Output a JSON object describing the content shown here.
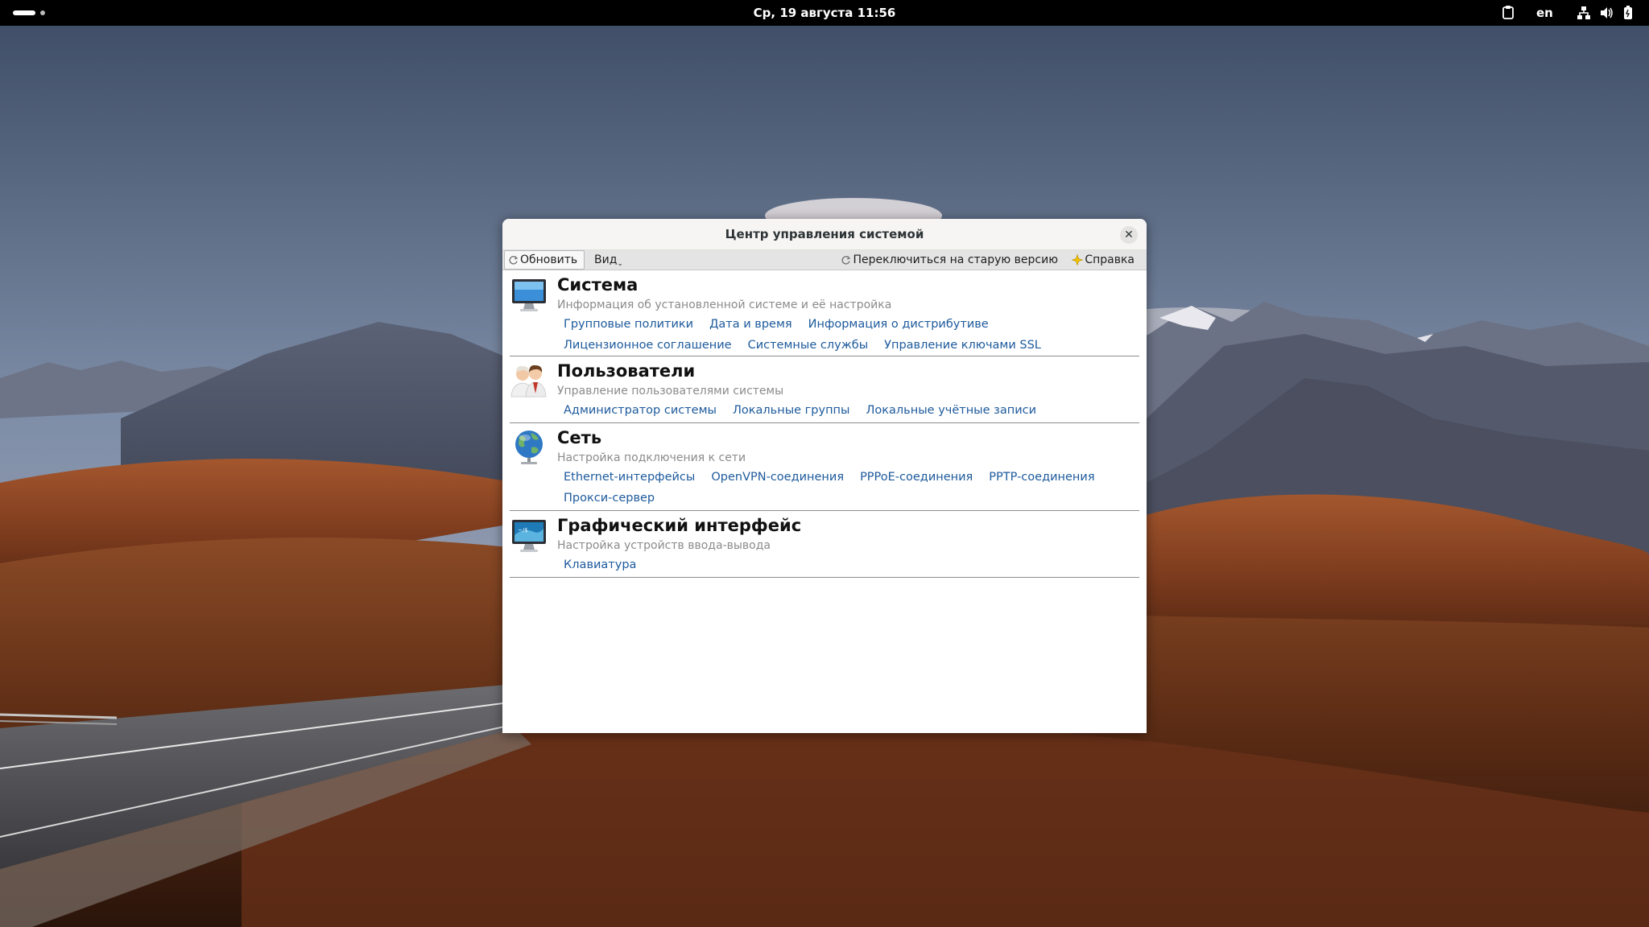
{
  "topbar": {
    "clock": "Ср, 19 августа  11:56",
    "language": "en",
    "icons": [
      "clipboard-icon",
      "network-icon",
      "volume-icon",
      "battery-icon"
    ]
  },
  "window": {
    "title": "Центр управления системой",
    "close_symbol": "✕",
    "toolbar": {
      "refresh_label": "Обновить",
      "view_label": "Вид",
      "old_version_label": "Переключиться на старую версию",
      "help_label": "Справка"
    },
    "sections": [
      {
        "title": "Система",
        "description": "Информация об установленной системе и её настройка",
        "icon": "monitor-icon",
        "links": [
          [
            "Групповые политики",
            "Дата и время",
            "Информация о дистрибутиве"
          ],
          [
            "Лицензионное соглашение",
            "Системные службы",
            "Управление ключами SSL"
          ]
        ]
      },
      {
        "title": "Пользователи",
        "description": "Управление пользователями системы",
        "icon": "users-icon",
        "links": [
          [
            "Администратор системы",
            "Локальные группы",
            "Локальные учётные записи"
          ]
        ]
      },
      {
        "title": "Сеть",
        "description": "Настройка подключения к сети",
        "icon": "globe-icon",
        "links": [
          [
            "Ethernet-интерфейсы",
            "OpenVPN-соединения",
            "PPPoE-соединения",
            "PPTP-соединения"
          ],
          [
            "Прокси-сервер"
          ]
        ]
      },
      {
        "title": "Графический интерфейс",
        "description": "Настройка устройств ввода-вывода",
        "icon": "display-settings-icon",
        "links": [
          [
            "Клавиатура"
          ]
        ]
      }
    ]
  },
  "colors": {
    "link": "#1d5a9c",
    "description": "#8b8b8b",
    "toolbar_bg": "#e4e4e4",
    "topbar_bg": "#000000"
  }
}
